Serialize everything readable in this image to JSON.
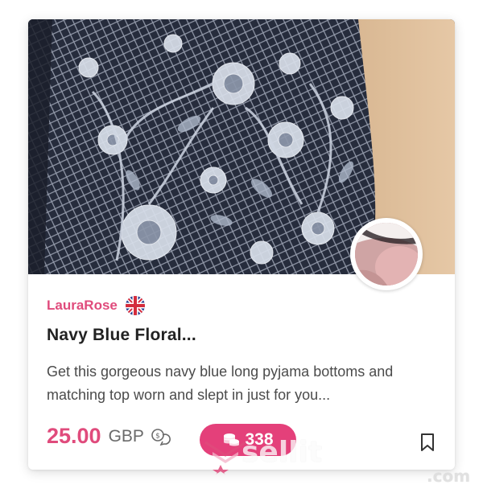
{
  "listing": {
    "seller_name": "LauraRose",
    "seller_flag": "uk-flag-icon",
    "title": "Navy Blue Floral...",
    "description": "Get this gorgeous navy blue long pyjama bottoms and matching top worn and slept in just for you...",
    "price": "25.00",
    "currency": "GBP",
    "coin_count": "338",
    "bookmark_icon": "bookmark-icon",
    "chat_icon": "chat-coin-icon",
    "coin_icon": "coin-stack-icon"
  },
  "watermark": {
    "text": "sellit",
    "suffix": ".com"
  },
  "colors": {
    "accent": "#e04b7c",
    "badge": "#e4407a",
    "title": "#222222",
    "body": "#4b4b4b"
  }
}
